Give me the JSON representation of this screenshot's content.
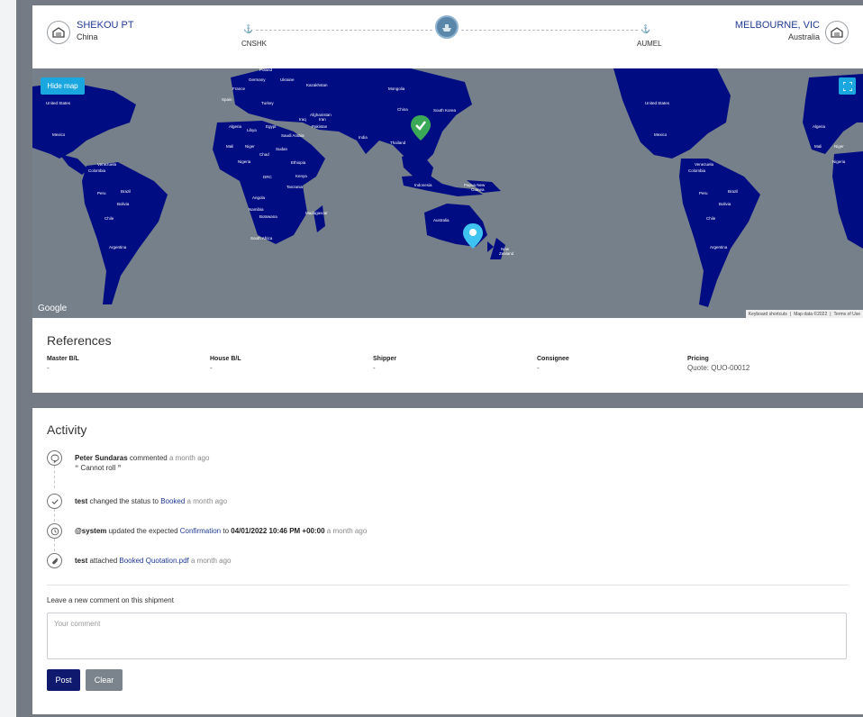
{
  "route": {
    "origin": {
      "name": "SHEKOU PT",
      "country": "China",
      "code": "CNSHK"
    },
    "destination": {
      "name": "MELBOURNE, VIC",
      "country": "Australia",
      "code": "AUMEL"
    }
  },
  "map": {
    "hide_label": "Hide map",
    "google": "Google",
    "attribution": [
      "Keyboard shortcuts",
      "Map data ©2022",
      "Terms of Use"
    ],
    "water_color": "#76808b",
    "land_color": "#000c82",
    "origin_marker_color": "#3aa856",
    "destination_marker_color": "#3ec2f0",
    "labels": {
      "western": [
        "United States",
        "Mexico",
        "Venezuela",
        "Colombia",
        "Brazil",
        "Peru",
        "Bolivia",
        "Chile",
        "Argentina"
      ],
      "eurasia": [
        "Poland",
        "Germany",
        "Ukraine",
        "France",
        "Spain",
        "Turkey",
        "Kazakhstan",
        "Mongolia",
        "China",
        "South Korea",
        "Iraq",
        "Iran",
        "Afghanistan",
        "Pakistan",
        "India",
        "Thailand",
        "Saudi Arabia",
        "Egypt",
        "Algeria",
        "Libya"
      ],
      "africa": [
        "Mali",
        "Niger",
        "Chad",
        "Sudan",
        "Nigeria",
        "Ethiopia",
        "DRC",
        "Kenya",
        "Tanzania",
        "Angola",
        "Namibia",
        "Botswana",
        "Madagascar",
        "South Africa"
      ],
      "oceania": [
        "Indonesia",
        "Papua New Guinea",
        "Australia",
        "New Zealand"
      ],
      "east_edge": [
        "Algeria",
        "Mali",
        "Niger",
        "Nigeria"
      ]
    }
  },
  "references": {
    "title": "References",
    "columns": [
      {
        "label": "Master B/L",
        "value": "-"
      },
      {
        "label": "House B/L",
        "value": "-"
      },
      {
        "label": "Shipper",
        "value": "-"
      },
      {
        "label": "Consignee",
        "value": "-"
      },
      {
        "label": "Pricing",
        "value": "Quote: QUO-00012"
      }
    ]
  },
  "activity": {
    "title": "Activity",
    "items": [
      {
        "icon": "comment-icon",
        "actor": "Peter Sundaras",
        "action": " commented ",
        "time": "a month ago",
        "quote": "Cannot roll"
      },
      {
        "icon": "check-icon",
        "actor": "test",
        "action": " changed the status to ",
        "link": "Booked",
        "time": " a month ago"
      },
      {
        "icon": "clock-icon",
        "actor": "@system",
        "action": " updated the expected ",
        "link": "Confirmation",
        "mid": " to ",
        "bold2": "04/01/2022 10:46 PM +00:00",
        "time": " a month ago"
      },
      {
        "icon": "paperclip-icon",
        "actor": "test",
        "action": " attached ",
        "link": "Booked Quotation.pdf",
        "time": " a month ago"
      }
    ],
    "leave_label": "Leave a new comment on this shipment",
    "comment_placeholder": "Your comment",
    "post_label": "Post",
    "clear_label": "Clear"
  }
}
